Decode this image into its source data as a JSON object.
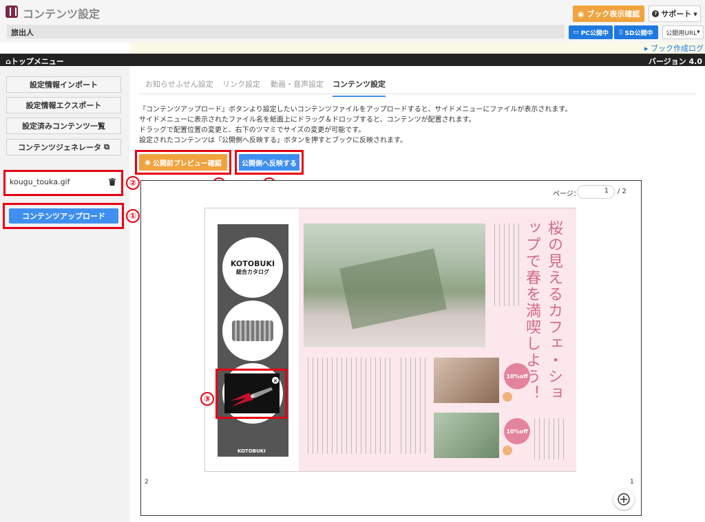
{
  "header": {
    "app_title": "コンテンツ設定",
    "preview_book_label": "ブック表示確認",
    "support_label": "サポート",
    "publisher_name": "旅出人",
    "pc_status": "PC公開中",
    "sd_status": "SD公開中",
    "public_url_label": "公開用URL",
    "create_log_link": "ブック作成ログ"
  },
  "nav": {
    "home_label": "トップメニュー",
    "version": "バージョン 4.0"
  },
  "sidebar": {
    "buttons": [
      "設定情報インポート",
      "設定情報エクスポート",
      "設定済みコンテンツ一覧",
      "コンテンツジェネレータ"
    ],
    "file_name": "kougu_touka.gif",
    "upload_label": "コンテンツアップロード"
  },
  "tabs": [
    "お知らせふせん設定",
    "リンク設定",
    "動画・音声設定",
    "コンテンツ設定"
  ],
  "description": [
    "『コンテンツアップロード』ボタンより設定したいコンテンツファイルをアップロードすると、サイドメニューにファイルが表示されます。",
    "サイドメニューに表示されたファイル名を紙面上にドラッグ＆ドロップすると、コンテンツが配置されます。",
    "ドラッグで配置位置の変更と、右下のツマミでサイズの変更が可能です。",
    "設定されたコンテンツは『公開側へ反映する』ボタンを押すとブックに反映されます。"
  ],
  "actions": {
    "preview_label": "公開前プレビュー確認",
    "publish_label": "公開側へ反映する"
  },
  "annotations": [
    "①",
    "②",
    "③",
    "④",
    "⑤"
  ],
  "viewer": {
    "page_label": "ページ：",
    "page_value": "1",
    "page_total": "/ 2",
    "left_page_num": "2",
    "right_page_num": "1",
    "zoom_symbol": "+"
  },
  "book": {
    "logo": "KOTOBUKI",
    "catalog": "総合カタログ",
    "footer_logo": "KOTOBUKI",
    "title": "桜の見えるカフェ・ショップで春を満喫しよう！",
    "discount": "10%off"
  },
  "colors": {
    "orange": "#f0a33e",
    "blue": "#3f8ff0",
    "annotation_red": "#e60012",
    "pink_page": "#fbe7ec"
  }
}
